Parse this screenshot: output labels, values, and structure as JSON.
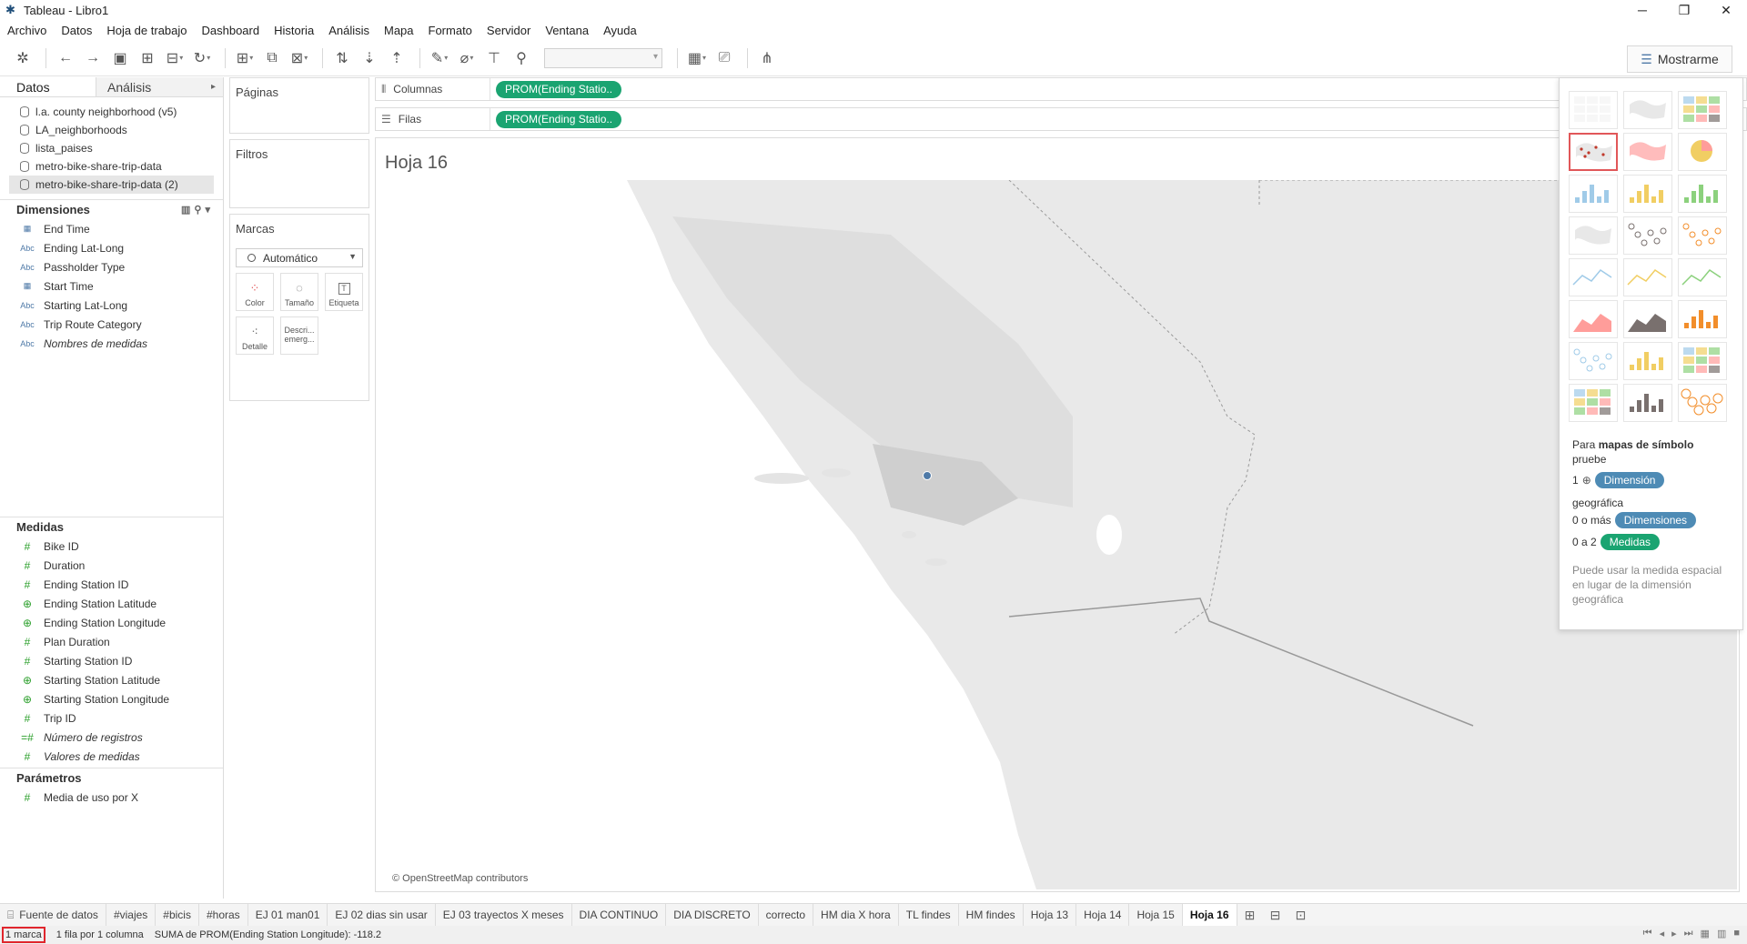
{
  "window": {
    "title": "Tableau - Libro1",
    "minimize": "─",
    "restore": "❐",
    "close": "✕"
  },
  "menu": [
    "Archivo",
    "Datos",
    "Hoja de trabajo",
    "Dashboard",
    "Historia",
    "Análisis",
    "Mapa",
    "Formato",
    "Servidor",
    "Ventana",
    "Ayuda"
  ],
  "toolbar": {
    "show_me_label": "Mostrarme"
  },
  "datapane": {
    "tab_data": "Datos",
    "tab_analysis": "Análisis",
    "datasources": [
      "l.a. county neighborhood (v5)",
      "LA_neighborhoods",
      "lista_paises",
      "metro-bike-share-trip-data",
      "metro-bike-share-trip-data (2)"
    ],
    "dimensions_title": "Dimensiones",
    "dimensions": [
      {
        "type": "▦",
        "label": "End Time"
      },
      {
        "type": "Abc",
        "label": "Ending Lat-Long"
      },
      {
        "type": "Abc",
        "label": "Passholder Type"
      },
      {
        "type": "▦",
        "label": "Start Time"
      },
      {
        "type": "Abc",
        "label": "Starting Lat-Long"
      },
      {
        "type": "Abc",
        "label": "Trip Route Category"
      },
      {
        "type": "Abc",
        "label": "Nombres de medidas"
      }
    ],
    "measures_title": "Medidas",
    "measures": [
      {
        "type": "#",
        "label": "Bike ID"
      },
      {
        "type": "#",
        "label": "Duration"
      },
      {
        "type": "#",
        "label": "Ending Station ID"
      },
      {
        "type": "⊕",
        "label": "Ending Station Latitude"
      },
      {
        "type": "⊕",
        "label": "Ending Station Longitude"
      },
      {
        "type": "#",
        "label": "Plan Duration"
      },
      {
        "type": "#",
        "label": "Starting Station ID"
      },
      {
        "type": "⊕",
        "label": "Starting Station Latitude"
      },
      {
        "type": "⊕",
        "label": "Starting Station Longitude"
      },
      {
        "type": "#",
        "label": "Trip ID"
      },
      {
        "type": "=#",
        "label": "Número de registros"
      },
      {
        "type": "#",
        "label": "Valores de medidas"
      }
    ],
    "parameters_title": "Parámetros",
    "parameters": [
      {
        "type": "#",
        "label": "Media de uso por X"
      }
    ]
  },
  "cards": {
    "pages": "Páginas",
    "filters": "Filtros",
    "marks": "Marcas",
    "mark_type": "Automático",
    "mark_buttons": [
      {
        "icon": "⁘",
        "label": "Color"
      },
      {
        "icon": "◌",
        "label": "Tamaño"
      },
      {
        "icon": "T",
        "label": "Etiqueta"
      },
      {
        "icon": "⁖",
        "label": "Detalle"
      },
      {
        "icon": "",
        "label": "Descri... emerg..."
      }
    ]
  },
  "shelves": {
    "columns_label": "Columnas",
    "columns_pill": "PROM(Ending Statio..",
    "rows_label": "Filas",
    "rows_pill": "PROM(Ending Statio.."
  },
  "view": {
    "sheet_title": "Hoja 16",
    "map_credit": "© OpenStreetMap contributors",
    "mark_color": "#4e79a7"
  },
  "showme": {
    "hint_lead": "Para",
    "hint_bold": "mapas de símbolo",
    "hint_tail": "pruebe",
    "row1_prefix": "1",
    "row1_badge": "Dimensión",
    "row1_suffix": "geográfica",
    "row2_prefix": "0 o más",
    "row2_badge": "Dimensiones",
    "row3_prefix": "0 a 2",
    "row3_badge": "Medidas",
    "note": "Puede usar la medida espacial en lugar de la dimensión geográfica"
  },
  "sheet_tabs": {
    "datasource": "Fuente de datos",
    "tabs": [
      "#viajes",
      "#bicis",
      "#horas",
      "EJ 01 man01",
      "EJ 02 dias sin usar",
      "EJ 03 trayectos X meses",
      "DIA CONTINUO",
      "DIA DISCRETO",
      "correcto",
      "HM dia X hora",
      "TL findes",
      "HM findes",
      "Hoja 13",
      "Hoja 14",
      "Hoja 15",
      "Hoja 16"
    ],
    "active": "Hoja 16"
  },
  "status": {
    "marks": "1 marca",
    "rows_cols": "1 fila por 1 columna",
    "sum": "SUMA de PROM(Ending Station Longitude): -118.2"
  }
}
